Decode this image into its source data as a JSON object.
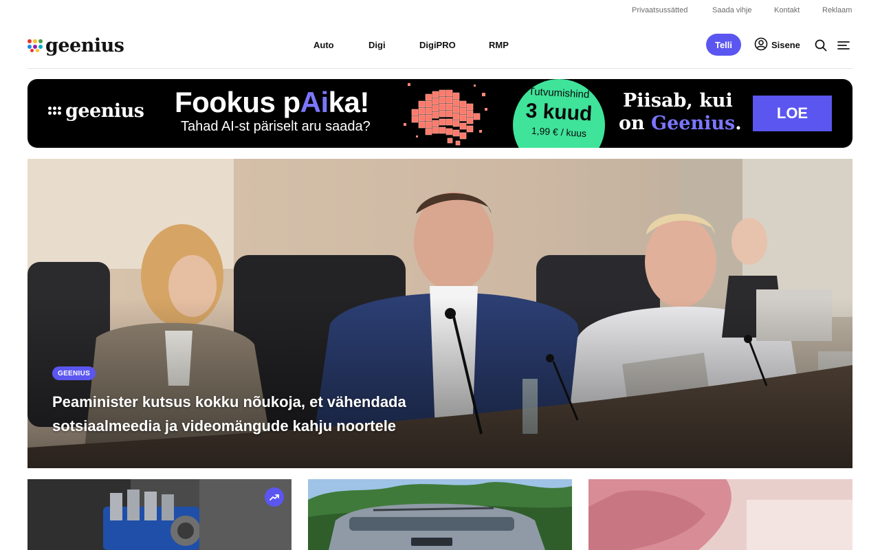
{
  "utility_links": [
    "Privaatsussätted",
    "Saada vihje",
    "Kontakt",
    "Reklaam"
  ],
  "header": {
    "logo_text": "geenius",
    "nav": [
      "Auto",
      "Digi",
      "DigiPRO",
      "RMP"
    ],
    "subscribe_label": "Telli",
    "login_label": "Sisene"
  },
  "banner": {
    "logo_text": "geenius",
    "headline_pre": "Fookus p",
    "headline_accent": "Ai",
    "headline_post": "ka!",
    "subline": "Tahad AI-st päriselt aru saada?",
    "offer_line1": "Tutvumishind",
    "offer_line2": "3 kuud",
    "offer_line3": "1,99 € / kuus",
    "tagline1": "Piisab, kui",
    "tagline2_pre": "on ",
    "tagline2_brand": "Geenius",
    "tagline2_post": ".",
    "cta_label": "LOE"
  },
  "hero": {
    "badge": "GEENIUS",
    "title": "Peaminister kutsus kokku nõukoja, et vähendada sotsiaalmeedia ja videomängude kahju noortele"
  },
  "colors": {
    "accent": "#5b56f0",
    "accent_light": "#7b76ff",
    "offer_green": "#3fe39a",
    "logo_dots": [
      "#e53935",
      "#fbc02d",
      "#43a047",
      "#1e88e5",
      "#8e24aa",
      "#00acc1"
    ]
  },
  "icons": [
    "user-circle-icon",
    "search-icon",
    "menu-icon",
    "trending-icon"
  ]
}
